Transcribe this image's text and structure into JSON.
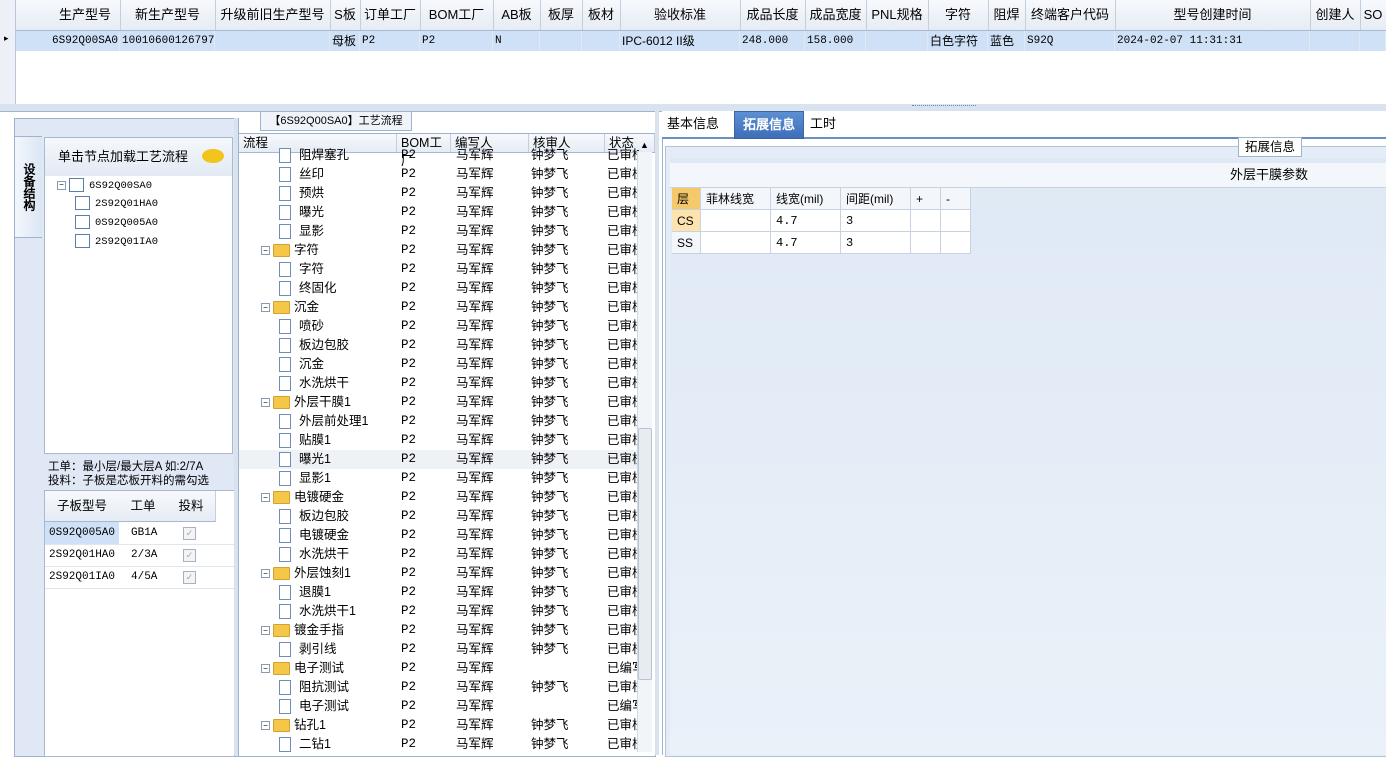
{
  "top_grid": {
    "columns": [
      "生产型号",
      "新生产型号",
      "升级前旧生产型号",
      "S板",
      "订单工厂",
      "BOM工厂",
      "AB板",
      "板厚",
      "板材",
      "验收标准",
      "成品长度",
      "成品宽度",
      "PNL规格",
      "字符",
      "阻焊",
      "终端客户代码",
      "型号创建时间",
      "创建人",
      "SO"
    ],
    "row": {
      "indicator": "▸",
      "cells": [
        "6S92Q00SA0",
        "10010600126797",
        "",
        "母板",
        "P2",
        "P2",
        "N",
        "",
        "",
        "IPC-6012 II级",
        "248.000",
        "158.000",
        "",
        "白色字符",
        "蓝色",
        "S92Q",
        "2024-02-07 11:31:31",
        "",
        ""
      ]
    }
  },
  "left": {
    "side_tab": "设备结构",
    "tree_title": "单击节点加载工艺流程",
    "tree": [
      {
        "label": "6S92Q00SA0",
        "expander": "−"
      },
      {
        "label": "2S92Q01HA0"
      },
      {
        "label": "0S92Q005A0"
      },
      {
        "label": "2S92Q01IA0"
      }
    ],
    "note_line1": "工单：最小层/最大层A 如:2/7A",
    "note_line2": "投料：子板是芯板开料的需勾选",
    "sub_columns": [
      "子板型号",
      "工单",
      "投料"
    ],
    "sub_rows": [
      {
        "model": "0S92Q005A0",
        "order": "GB1A",
        "checked": "✓"
      },
      {
        "model": "2S92Q01HA0",
        "order": "2/3A",
        "checked": "✓"
      },
      {
        "model": "2S92Q01IA0",
        "order": "4/5A",
        "checked": "✓"
      }
    ]
  },
  "flow": {
    "title": "【6S92Q00SA0】工艺流程",
    "columns": [
      "流程",
      "BOM工厂",
      "编写人",
      "核审人",
      "状态"
    ],
    "rows": [
      {
        "name": "阻焊塞孔",
        "kind": "child",
        "bom": "P2",
        "writer": "马军辉",
        "reviewer": "钟梦飞",
        "status": "已审核"
      },
      {
        "name": "丝印",
        "kind": "child",
        "bom": "P2",
        "writer": "马军辉",
        "reviewer": "钟梦飞",
        "status": "已审核"
      },
      {
        "name": "预烘",
        "kind": "child",
        "bom": "P2",
        "writer": "马军辉",
        "reviewer": "钟梦飞",
        "status": "已审核"
      },
      {
        "name": "曝光",
        "kind": "child",
        "bom": "P2",
        "writer": "马军辉",
        "reviewer": "钟梦飞",
        "status": "已审核"
      },
      {
        "name": "显影",
        "kind": "child",
        "bom": "P2",
        "writer": "马军辉",
        "reviewer": "钟梦飞",
        "status": "已审核"
      },
      {
        "name": "字符",
        "kind": "folder",
        "bom": "P2",
        "writer": "马军辉",
        "reviewer": "钟梦飞",
        "status": "已审核"
      },
      {
        "name": "字符",
        "kind": "child",
        "bom": "P2",
        "writer": "马军辉",
        "reviewer": "钟梦飞",
        "status": "已审核"
      },
      {
        "name": "终固化",
        "kind": "child",
        "bom": "P2",
        "writer": "马军辉",
        "reviewer": "钟梦飞",
        "status": "已审核"
      },
      {
        "name": "沉金",
        "kind": "folder",
        "bom": "P2",
        "writer": "马军辉",
        "reviewer": "钟梦飞",
        "status": "已审核"
      },
      {
        "name": "喷砂",
        "kind": "child",
        "bom": "P2",
        "writer": "马军辉",
        "reviewer": "钟梦飞",
        "status": "已审核"
      },
      {
        "name": "板边包胶",
        "kind": "child",
        "bom": "P2",
        "writer": "马军辉",
        "reviewer": "钟梦飞",
        "status": "已审核"
      },
      {
        "name": "沉金",
        "kind": "child",
        "bom": "P2",
        "writer": "马军辉",
        "reviewer": "钟梦飞",
        "status": "已审核"
      },
      {
        "name": "水洗烘干",
        "kind": "child",
        "bom": "P2",
        "writer": "马军辉",
        "reviewer": "钟梦飞",
        "status": "已审核"
      },
      {
        "name": "外层干膜1",
        "kind": "folder",
        "bom": "P2",
        "writer": "马军辉",
        "reviewer": "钟梦飞",
        "status": "已审核"
      },
      {
        "name": "外层前处理1",
        "kind": "child",
        "bom": "P2",
        "writer": "马军辉",
        "reviewer": "钟梦飞",
        "status": "已审核"
      },
      {
        "name": "贴膜1",
        "kind": "child",
        "bom": "P2",
        "writer": "马军辉",
        "reviewer": "钟梦飞",
        "status": "已审核"
      },
      {
        "name": "曝光1",
        "kind": "child",
        "bom": "P2",
        "writer": "马军辉",
        "reviewer": "钟梦飞",
        "status": "已审核",
        "selected": true
      },
      {
        "name": "显影1",
        "kind": "child",
        "bom": "P2",
        "writer": "马军辉",
        "reviewer": "钟梦飞",
        "status": "已审核"
      },
      {
        "name": "电镀硬金",
        "kind": "folder",
        "bom": "P2",
        "writer": "马军辉",
        "reviewer": "钟梦飞",
        "status": "已审核"
      },
      {
        "name": "板边包胶",
        "kind": "child",
        "bom": "P2",
        "writer": "马军辉",
        "reviewer": "钟梦飞",
        "status": "已审核"
      },
      {
        "name": "电镀硬金",
        "kind": "child",
        "bom": "P2",
        "writer": "马军辉",
        "reviewer": "钟梦飞",
        "status": "已审核"
      },
      {
        "name": "水洗烘干",
        "kind": "child",
        "bom": "P2",
        "writer": "马军辉",
        "reviewer": "钟梦飞",
        "status": "已审核"
      },
      {
        "name": "外层蚀刻1",
        "kind": "folder",
        "bom": "P2",
        "writer": "马军辉",
        "reviewer": "钟梦飞",
        "status": "已审核"
      },
      {
        "name": "退膜1",
        "kind": "child",
        "bom": "P2",
        "writer": "马军辉",
        "reviewer": "钟梦飞",
        "status": "已审核"
      },
      {
        "name": "水洗烘干1",
        "kind": "child",
        "bom": "P2",
        "writer": "马军辉",
        "reviewer": "钟梦飞",
        "status": "已审核"
      },
      {
        "name": "镀金手指",
        "kind": "folder",
        "bom": "P2",
        "writer": "马军辉",
        "reviewer": "钟梦飞",
        "status": "已审核"
      },
      {
        "name": "剥引线",
        "kind": "child",
        "bom": "P2",
        "writer": "马军辉",
        "reviewer": "钟梦飞",
        "status": "已审核"
      },
      {
        "name": "电子测试",
        "kind": "folder",
        "bom": "P2",
        "writer": "马军辉",
        "reviewer": "",
        "status": "已编写"
      },
      {
        "name": "阻抗测试",
        "kind": "child",
        "bom": "P2",
        "writer": "马军辉",
        "reviewer": "钟梦飞",
        "status": "已审核"
      },
      {
        "name": "电子测试",
        "kind": "child",
        "bom": "P2",
        "writer": "马军辉",
        "reviewer": "",
        "status": "已编写"
      },
      {
        "name": "钻孔1",
        "kind": "folder",
        "bom": "P2",
        "writer": "马军辉",
        "reviewer": "钟梦飞",
        "status": "已审核"
      },
      {
        "name": "二钻1",
        "kind": "child",
        "bom": "P2",
        "writer": "马军辉",
        "reviewer": "钟梦飞",
        "status": "已审核"
      }
    ]
  },
  "right": {
    "tabs": [
      "基本信息",
      "拓展信息",
      "工时"
    ],
    "active_tab": "拓展信息",
    "group_title": "拓展信息",
    "section_title": "外层干膜参数",
    "columns": [
      "层",
      "菲林线宽",
      "线宽(mil)",
      "间距(mil)",
      "+",
      "-"
    ],
    "rows": [
      {
        "layer": "CS",
        "film_width": "",
        "width": "4.7",
        "space": "3"
      },
      {
        "layer": "SS",
        "film_width": "",
        "width": "4.7",
        "space": "3"
      }
    ]
  },
  "colors": {
    "selected_row": "#cfe1f7",
    "active_tab": "#4a7cc4",
    "panel_bg": "#dfe8f4",
    "folder": "#f5c748"
  }
}
